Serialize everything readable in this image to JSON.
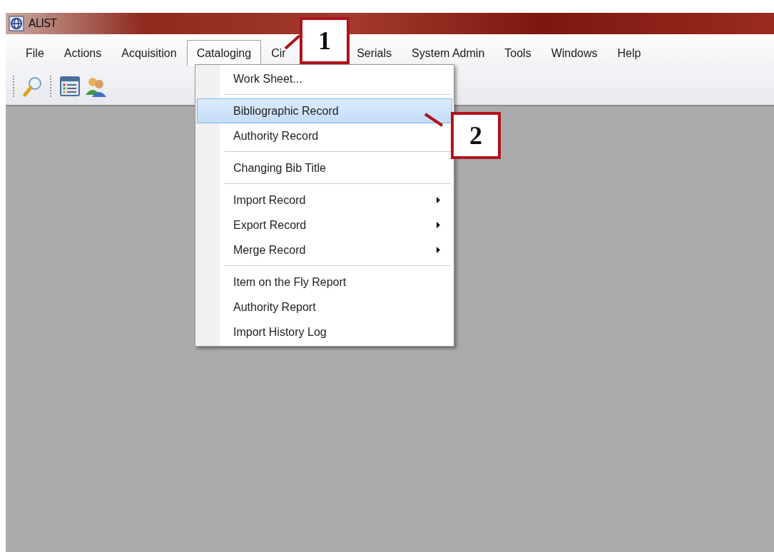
{
  "window": {
    "title": "ALIST"
  },
  "menubar": [
    {
      "label": "File",
      "selected": false
    },
    {
      "label": "Actions",
      "selected": false
    },
    {
      "label": "Acquisition",
      "selected": false
    },
    {
      "label": "Cataloging",
      "selected": true
    },
    {
      "label": "Cir",
      "selected": false
    },
    {
      "label": "Serials",
      "selected": false
    },
    {
      "label": "System Admin",
      "selected": false
    },
    {
      "label": "Tools",
      "selected": false
    },
    {
      "label": "Windows",
      "selected": false
    },
    {
      "label": "Help",
      "selected": false
    }
  ],
  "dropdown": {
    "groups": [
      [
        {
          "label": "Work Sheet...",
          "selected": false,
          "submenu": false
        }
      ],
      [
        {
          "label": "Bibliographic Record",
          "selected": true,
          "submenu": false
        },
        {
          "label": "Authority Record",
          "selected": false,
          "submenu": false
        }
      ],
      [
        {
          "label": "Changing Bib Title",
          "selected": false,
          "submenu": false
        }
      ],
      [
        {
          "label": "Import Record",
          "selected": false,
          "submenu": true
        },
        {
          "label": "Export Record",
          "selected": false,
          "submenu": true
        },
        {
          "label": "Merge Record",
          "selected": false,
          "submenu": true
        }
      ],
      [
        {
          "label": "Item on the Fly Report",
          "selected": false,
          "submenu": false
        },
        {
          "label": "Authority Report",
          "selected": false,
          "submenu": false
        },
        {
          "label": "Import History Log",
          "selected": false,
          "submenu": false
        }
      ]
    ]
  },
  "callouts": [
    {
      "label": "1"
    },
    {
      "label": "2"
    }
  ]
}
